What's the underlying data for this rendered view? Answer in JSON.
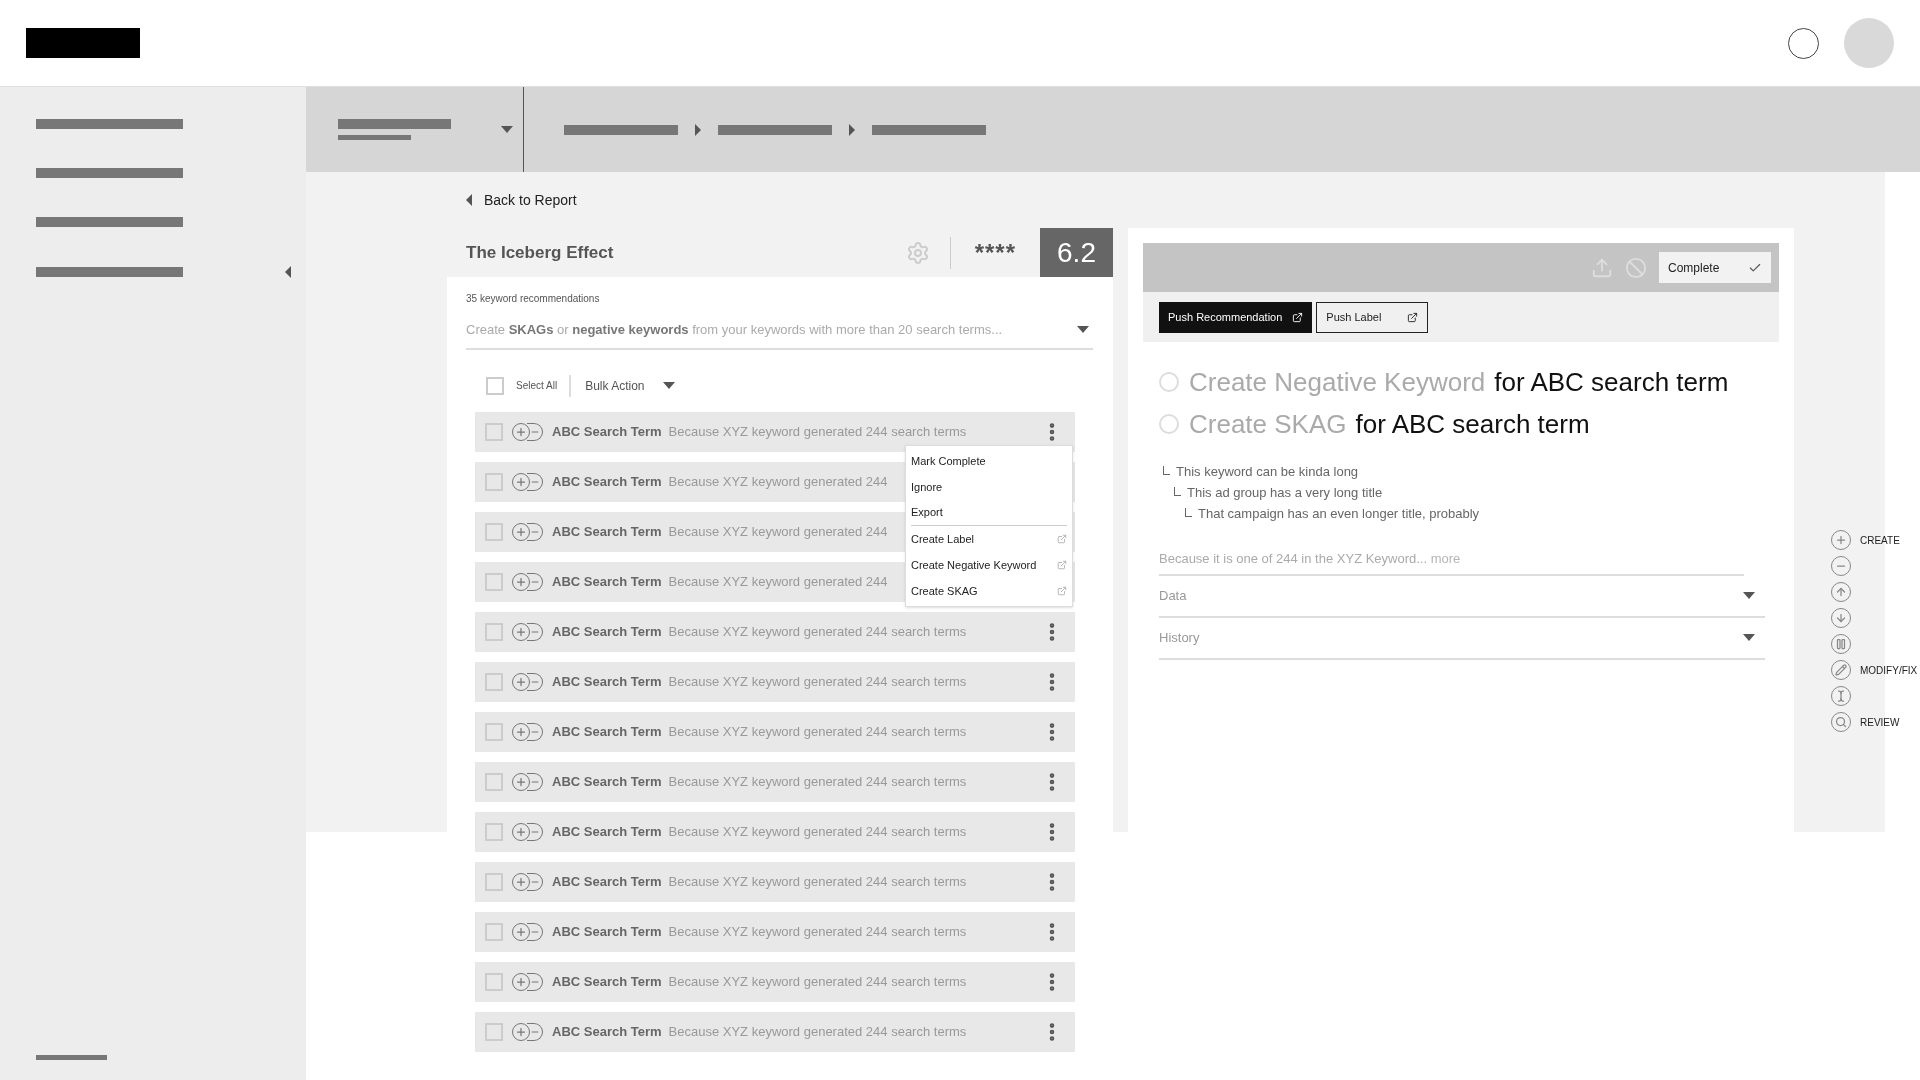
{
  "back_link": "Back to Report",
  "report": {
    "title": "The Iceberg Effect",
    "stars": "****",
    "score": "6.2",
    "count": "35 keyword recommendations",
    "subtitle": "Create **SKAGs** or **negative keywords** from your keywords with more than 20 search terms..."
  },
  "toolbar": {
    "select_all": {
      "label": "Select All",
      "checked": false
    },
    "bulk_action": "Bulk Action"
  },
  "rows": [
    {
      "term": "ABC Search Term",
      "reason": "Because XYZ keyword generated 244 search terms",
      "checked": false
    },
    {
      "term": "ABC Search Term",
      "reason": "Because XYZ keyword generated 244",
      "checked": false
    },
    {
      "term": "ABC Search Term",
      "reason": "Because XYZ keyword generated 244",
      "checked": false
    },
    {
      "term": "ABC Search Term",
      "reason": "Because XYZ keyword generated 244",
      "checked": false
    },
    {
      "term": "ABC Search Term",
      "reason": "Because XYZ keyword generated 244 search terms",
      "checked": false
    },
    {
      "term": "ABC Search Term",
      "reason": "Because XYZ keyword generated 244 search terms",
      "checked": false
    },
    {
      "term": "ABC Search Term",
      "reason": "Because XYZ keyword generated 244 search terms",
      "checked": false
    },
    {
      "term": "ABC Search Term",
      "reason": "Because XYZ keyword generated 244 search terms",
      "checked": false
    },
    {
      "term": "ABC Search Term",
      "reason": "Because XYZ keyword generated 244 search terms",
      "checked": false
    },
    {
      "term": "ABC Search Term",
      "reason": "Because XYZ keyword generated 244 search terms",
      "checked": false
    },
    {
      "term": "ABC Search Term",
      "reason": "Because XYZ keyword generated 244 search terms",
      "checked": false
    },
    {
      "term": "ABC Search Term",
      "reason": "Because XYZ keyword generated 244 search terms",
      "checked": false
    },
    {
      "term": "ABC Search Term",
      "reason": "Because XYZ keyword generated 244 search terms",
      "checked": false
    }
  ],
  "context_menu": [
    {
      "label": "Mark Complete",
      "external": false,
      "divider_after": false
    },
    {
      "label": "Ignore",
      "external": false,
      "divider_after": false
    },
    {
      "label": "Export",
      "external": false,
      "divider_after": true
    },
    {
      "label": "Create Label",
      "external": true,
      "divider_after": false
    },
    {
      "label": "Create Negative Keyword",
      "external": true,
      "divider_after": false
    },
    {
      "label": "Create SKAG",
      "external": true,
      "divider_after": false
    }
  ],
  "detail": {
    "complete_button": "Complete",
    "push_recommendation": "Push Recommendation",
    "push_label": "Push Label",
    "options": [
      {
        "action": "Create Negative Keyword",
        "target": "for ABC search term",
        "selected": false
      },
      {
        "action": "Create SKAG",
        "target": "for ABC search term",
        "selected": false
      }
    ],
    "hierarchy": [
      {
        "text": "This keyword can be kinda long",
        "children": [
          {
            "text": "This ad group has a very long title",
            "children": [
              {
                "text": "That campaign has an even longer title, probably"
              }
            ]
          }
        ]
      }
    ],
    "description": "Because it is one of 244 in the XYZ Keyword...",
    "more_link": "more",
    "sections": [
      {
        "label": "Data",
        "expanded": false
      },
      {
        "label": "History",
        "expanded": false
      }
    ]
  },
  "rail": {
    "create_label": "CREATE",
    "modify_label": "MODIFY/FIX",
    "review_label": "REVIEW"
  }
}
